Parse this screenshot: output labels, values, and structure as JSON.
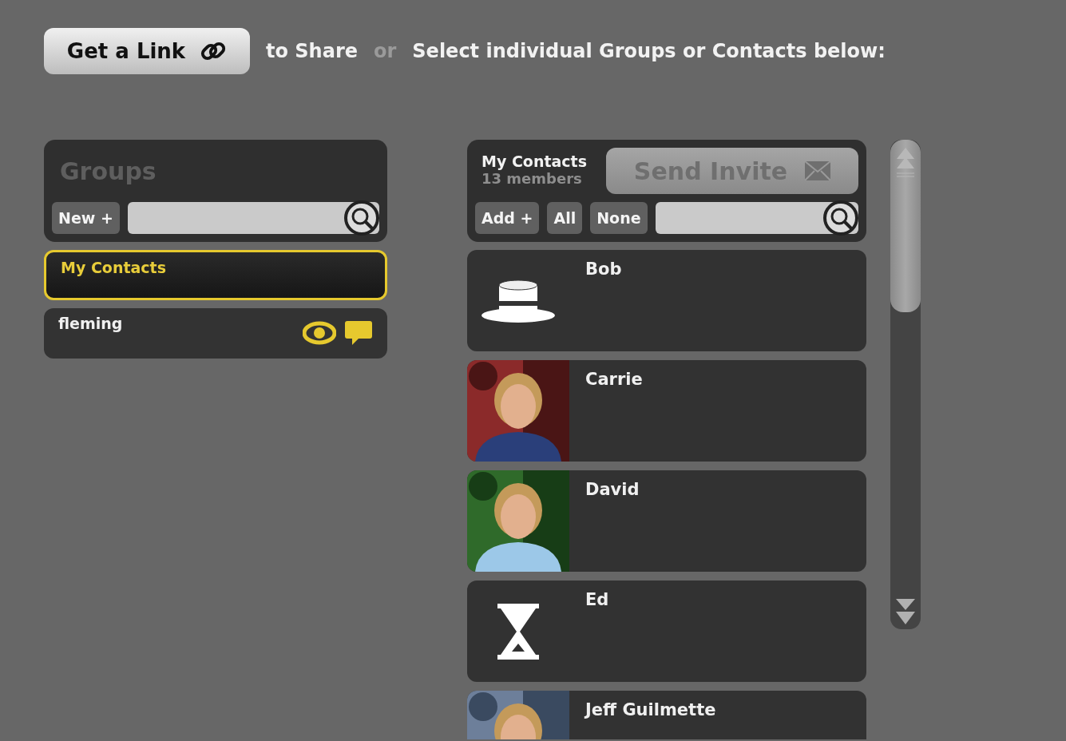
{
  "top_bar": {
    "link_button": "Get a Link",
    "share_text": "to Share",
    "or_text": "or",
    "select_text": "Select individual Groups or Contacts below:"
  },
  "groups_panel": {
    "title": "Groups",
    "new_button": "New +",
    "items": [
      {
        "name": "My Contacts",
        "selected": true,
        "kind": "plain"
      },
      {
        "name": "fleming",
        "selected": false,
        "kind": "shared"
      }
    ]
  },
  "contacts_panel": {
    "group_name": "My Contacts",
    "member_count": "13 members",
    "send_button": {
      "label": "Send Invite",
      "disabled": true
    },
    "add_button": "Add +",
    "all_button": "All",
    "none_button": "None",
    "contacts": [
      {
        "name": "Bob",
        "kind": "hat"
      },
      {
        "name": "Carrie",
        "kind": "picture"
      },
      {
        "name": "David",
        "kind": "picture"
      },
      {
        "name": "Ed",
        "kind": "hourglass"
      },
      {
        "name": "Jeff Guilmette",
        "kind": "picture"
      }
    ]
  }
}
